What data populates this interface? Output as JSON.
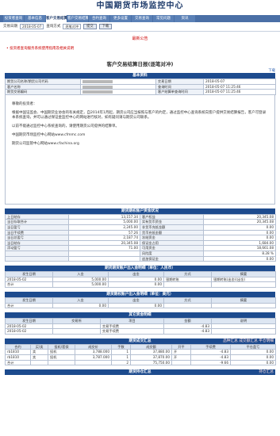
{
  "title": "中国期货市场监控中心",
  "tabs": [
    "投资者查询",
    "基本信息",
    "客户交易结算日报",
    "客户交易结算月报",
    "合约查询",
    "更多设置",
    "交易查询",
    "常见问题",
    "资讯"
  ],
  "active_tab": 2,
  "toolbar": {
    "date_label": "交易日期",
    "date_value": "2018-05-07",
    "type_label": "查询方式",
    "type_value": "逐笔对冲",
    "submit": "提交",
    "download": "下载"
  },
  "notice_title": "最新公告",
  "notice_text": "• 投资者查询服务系统使用指南及相关说明",
  "report_title": "客户交易结算日报(逐笔对冲)",
  "topic_link": "下载",
  "basic": {
    "title": "基本资料",
    "rows": [
      [
        "期货公司名称/期货公司代码",
        "",
        "交易日期",
        "2018-05-07"
      ],
      [
        "客户名称",
        "",
        "查询时间",
        "2018-05-07 11:25:46"
      ],
      [
        "期货交易编码",
        "",
        "客户结算单查询时间",
        "2018-05-07 11:25:46"
      ]
    ]
  },
  "letter": {
    "greeting": "尊敬的投资者：",
    "p1": "根据中国证监会、中国期货业协会的有关规定，自2014年1月起，期货公司应当按照与客户的约定，通过监控中心查询系统向客户提供交易结算报告，客户可登录本系统查询，并可以通过保证金监控中心的网站进行核对，如有疑问请与期货公司联系。",
    "p2": "以前不能通过监控中心系统查询的，请使用期货公司提供的结算单。",
    "p3": "中国期货市场监控中心网站www.cfmmc.com",
    "p4": "期货公司监管中心网站www.cfachina.org"
  },
  "funds": {
    "title": "期货期权账户资金状况",
    "rows": [
      [
        "上日结存",
        "13,157.34",
        "客户权益",
        "20,345.08"
      ],
      [
        "当日存取合计",
        "5,000.00",
        "实有货币资金",
        "20,345.08"
      ],
      [
        "当日盈亏",
        "2,245.00",
        "非货币充抵金额",
        "0.00"
      ],
      [
        "当日手续费",
        "57.26",
        "货币充抵金额",
        "0.00"
      ],
      [
        "当日总盈亏",
        "2,187.74",
        "冻结资金",
        "0.00"
      ],
      [
        "当日结存",
        "20,345.08",
        "保证金占用",
        "1,684.00"
      ],
      [
        "浮动盈亏",
        "71.00",
        "可用资金",
        "18,661.08"
      ],
      [
        "",
        "",
        "风险度",
        "8.28 %"
      ],
      [
        "",
        "",
        "追加保证金",
        "0.00"
      ]
    ]
  },
  "inout": {
    "title": "期货期货账户出入金明细（单位：人民币）",
    "headers": [
      "发生日期",
      "入金",
      "出金",
      "方式",
      "摘要"
    ],
    "rows": [
      [
        "2018-05-02",
        "5,000.00",
        "0.00",
        "银期转账",
        "银期转账(出金)(出金)"
      ]
    ],
    "total_label": "合计",
    "total_in": "5,000.00",
    "total_out": "0.00"
  },
  "inout_usd": {
    "title": "期货期权账户出入金明细（单位：美元）",
    "headers": [
      "发生日期",
      "入金",
      "出金",
      "方式",
      "摘要"
    ],
    "total_label": "合计",
    "total_in": "0.00",
    "total_out": "0.00"
  },
  "fees": {
    "title": "其它资金明细",
    "headers": [
      "发生日期",
      "交易所",
      "项目",
      "金额",
      "说明"
    ],
    "rows": [
      [
        "2018-05-02",
        "",
        "交易手续费",
        "-4.83",
        ""
      ],
      [
        "2018-05-02",
        "",
        "交易手续费",
        "-4.83",
        ""
      ]
    ]
  },
  "trades": {
    "title": "期货成交汇总",
    "headers": [
      "合约",
      "买/卖",
      "投机/套保",
      "成交价",
      "手数",
      "成交额",
      "开平",
      "手续费",
      "平仓盈亏"
    ],
    "rows": [
      [
        "rb1810",
        "卖",
        "投机",
        "3,788.000",
        "1",
        "37,880.00",
        "开",
        "-4.83",
        "0.00"
      ],
      [
        "rb1810",
        "卖",
        "投机",
        "3,787.000",
        "1",
        "37,870.00",
        "开",
        "-4.83",
        "0.00"
      ],
      [
        "合计",
        "",
        "",
        "",
        "2",
        "75,750.00",
        "",
        "-9.66",
        "0.00"
      ]
    ]
  },
  "hold_title": "期货持仓汇总",
  "hold_right": "持仓汇总",
  "trades_right": "品种汇总  成交额汇总  平仓明细"
}
